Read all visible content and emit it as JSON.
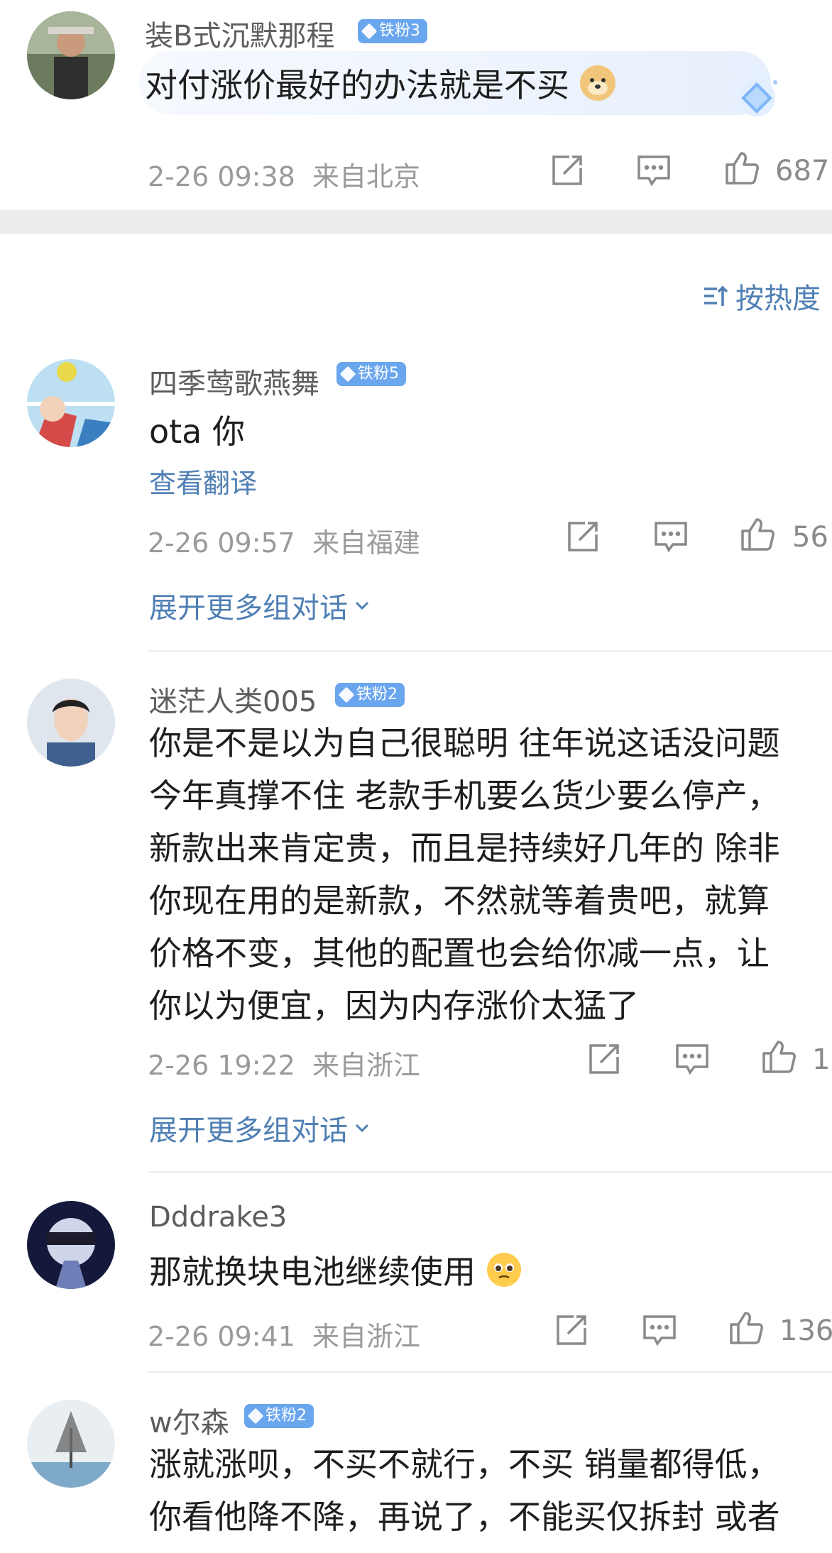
{
  "top_comment": {
    "username": "装B式沉默那程",
    "badge": "铁粉3",
    "content": "对付涨价最好的办法就是不买",
    "content_emoji": "doge-emoji",
    "date": "2-26 09:38",
    "location": "来自北京",
    "likes": "687"
  },
  "sort": {
    "label": "按热度",
    "icon": "sort-icon"
  },
  "comments": [
    {
      "username": "四季莺歌燕舞",
      "badge": "铁粉5",
      "content": "ota 你",
      "translate": "查看翻译",
      "date": "2-26 09:57",
      "location": "来自福建",
      "likes": "56",
      "expand": "展开更多组对话"
    },
    {
      "username": "迷茫人类005",
      "badge": "铁粉2",
      "content": "你是不是以为自己很聪明 往年说这话没问题\n今年真撑不住 老款手机要么货少要么停产，\n新款出来肯定贵，而且是持续好几年的 除非\n你现在用的是新款，不然就等着贵吧，就算\n价格不变，其他的配置也会给你减一点，让\n你以为便宜，因为内存涨价太猛了",
      "date": "2-26 19:22",
      "location": "来自浙江",
      "likes": "1",
      "expand": "展开更多组对话"
    },
    {
      "username": "Dddrake3",
      "content": "那就换块电池继续使用",
      "content_emoji": "pleading-face-emoji",
      "date": "2-26 09:41",
      "location": "来自浙江",
      "likes": "136"
    },
    {
      "username": "w尔森",
      "badge": "铁粉2",
      "content": "涨就涨呗，不买不就行，不买 销量都得低，\n你看他降不降，再说了，不能买仅拆封 或者"
    }
  ],
  "colors": {
    "link": "#4f7fb4",
    "badge": "#6aa6ee",
    "meta": "#9a9a9a",
    "separator": "#ededed"
  }
}
